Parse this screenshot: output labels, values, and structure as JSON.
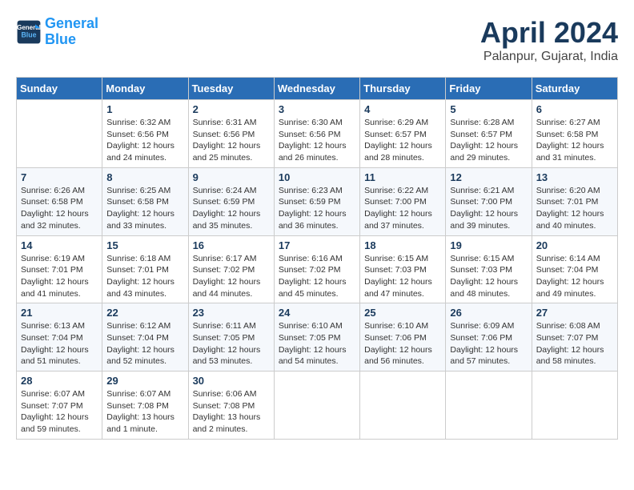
{
  "header": {
    "logo_line1": "General",
    "logo_line2": "Blue",
    "month_title": "April 2024",
    "location": "Palanpur, Gujarat, India"
  },
  "days_of_week": [
    "Sunday",
    "Monday",
    "Tuesday",
    "Wednesday",
    "Thursday",
    "Friday",
    "Saturday"
  ],
  "weeks": [
    [
      {
        "day": "",
        "info": ""
      },
      {
        "day": "1",
        "info": "Sunrise: 6:32 AM\nSunset: 6:56 PM\nDaylight: 12 hours\nand 24 minutes."
      },
      {
        "day": "2",
        "info": "Sunrise: 6:31 AM\nSunset: 6:56 PM\nDaylight: 12 hours\nand 25 minutes."
      },
      {
        "day": "3",
        "info": "Sunrise: 6:30 AM\nSunset: 6:56 PM\nDaylight: 12 hours\nand 26 minutes."
      },
      {
        "day": "4",
        "info": "Sunrise: 6:29 AM\nSunset: 6:57 PM\nDaylight: 12 hours\nand 28 minutes."
      },
      {
        "day": "5",
        "info": "Sunrise: 6:28 AM\nSunset: 6:57 PM\nDaylight: 12 hours\nand 29 minutes."
      },
      {
        "day": "6",
        "info": "Sunrise: 6:27 AM\nSunset: 6:58 PM\nDaylight: 12 hours\nand 31 minutes."
      }
    ],
    [
      {
        "day": "7",
        "info": "Sunrise: 6:26 AM\nSunset: 6:58 PM\nDaylight: 12 hours\nand 32 minutes."
      },
      {
        "day": "8",
        "info": "Sunrise: 6:25 AM\nSunset: 6:58 PM\nDaylight: 12 hours\nand 33 minutes."
      },
      {
        "day": "9",
        "info": "Sunrise: 6:24 AM\nSunset: 6:59 PM\nDaylight: 12 hours\nand 35 minutes."
      },
      {
        "day": "10",
        "info": "Sunrise: 6:23 AM\nSunset: 6:59 PM\nDaylight: 12 hours\nand 36 minutes."
      },
      {
        "day": "11",
        "info": "Sunrise: 6:22 AM\nSunset: 7:00 PM\nDaylight: 12 hours\nand 37 minutes."
      },
      {
        "day": "12",
        "info": "Sunrise: 6:21 AM\nSunset: 7:00 PM\nDaylight: 12 hours\nand 39 minutes."
      },
      {
        "day": "13",
        "info": "Sunrise: 6:20 AM\nSunset: 7:01 PM\nDaylight: 12 hours\nand 40 minutes."
      }
    ],
    [
      {
        "day": "14",
        "info": "Sunrise: 6:19 AM\nSunset: 7:01 PM\nDaylight: 12 hours\nand 41 minutes."
      },
      {
        "day": "15",
        "info": "Sunrise: 6:18 AM\nSunset: 7:01 PM\nDaylight: 12 hours\nand 43 minutes."
      },
      {
        "day": "16",
        "info": "Sunrise: 6:17 AM\nSunset: 7:02 PM\nDaylight: 12 hours\nand 44 minutes."
      },
      {
        "day": "17",
        "info": "Sunrise: 6:16 AM\nSunset: 7:02 PM\nDaylight: 12 hours\nand 45 minutes."
      },
      {
        "day": "18",
        "info": "Sunrise: 6:15 AM\nSunset: 7:03 PM\nDaylight: 12 hours\nand 47 minutes."
      },
      {
        "day": "19",
        "info": "Sunrise: 6:15 AM\nSunset: 7:03 PM\nDaylight: 12 hours\nand 48 minutes."
      },
      {
        "day": "20",
        "info": "Sunrise: 6:14 AM\nSunset: 7:04 PM\nDaylight: 12 hours\nand 49 minutes."
      }
    ],
    [
      {
        "day": "21",
        "info": "Sunrise: 6:13 AM\nSunset: 7:04 PM\nDaylight: 12 hours\nand 51 minutes."
      },
      {
        "day": "22",
        "info": "Sunrise: 6:12 AM\nSunset: 7:04 PM\nDaylight: 12 hours\nand 52 minutes."
      },
      {
        "day": "23",
        "info": "Sunrise: 6:11 AM\nSunset: 7:05 PM\nDaylight: 12 hours\nand 53 minutes."
      },
      {
        "day": "24",
        "info": "Sunrise: 6:10 AM\nSunset: 7:05 PM\nDaylight: 12 hours\nand 54 minutes."
      },
      {
        "day": "25",
        "info": "Sunrise: 6:10 AM\nSunset: 7:06 PM\nDaylight: 12 hours\nand 56 minutes."
      },
      {
        "day": "26",
        "info": "Sunrise: 6:09 AM\nSunset: 7:06 PM\nDaylight: 12 hours\nand 57 minutes."
      },
      {
        "day": "27",
        "info": "Sunrise: 6:08 AM\nSunset: 7:07 PM\nDaylight: 12 hours\nand 58 minutes."
      }
    ],
    [
      {
        "day": "28",
        "info": "Sunrise: 6:07 AM\nSunset: 7:07 PM\nDaylight: 12 hours\nand 59 minutes."
      },
      {
        "day": "29",
        "info": "Sunrise: 6:07 AM\nSunset: 7:08 PM\nDaylight: 13 hours\nand 1 minute."
      },
      {
        "day": "30",
        "info": "Sunrise: 6:06 AM\nSunset: 7:08 PM\nDaylight: 13 hours\nand 2 minutes."
      },
      {
        "day": "",
        "info": ""
      },
      {
        "day": "",
        "info": ""
      },
      {
        "day": "",
        "info": ""
      },
      {
        "day": "",
        "info": ""
      }
    ]
  ]
}
